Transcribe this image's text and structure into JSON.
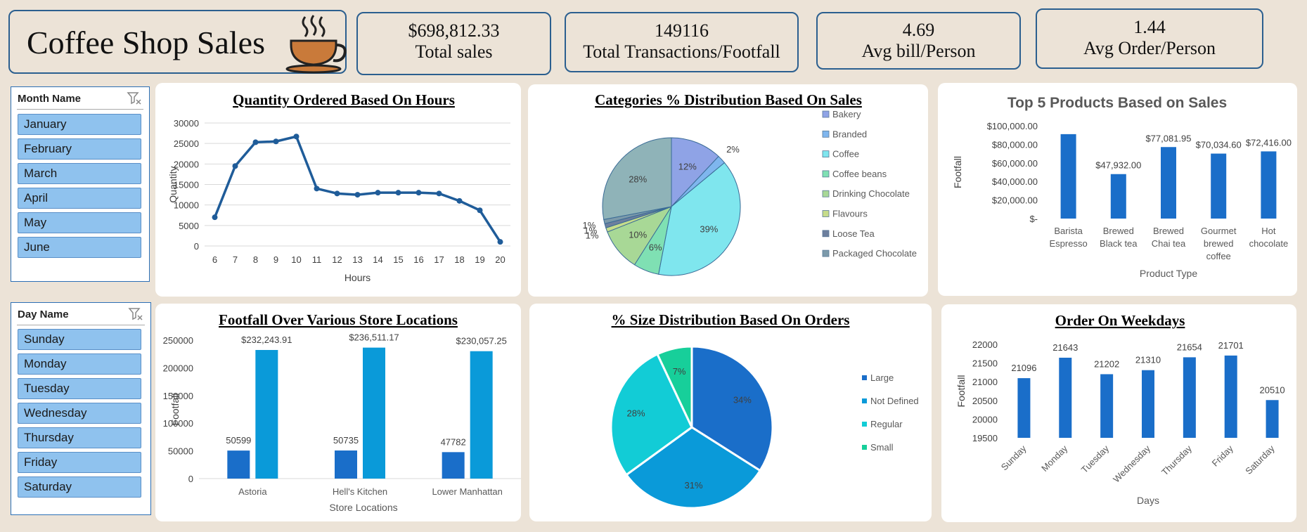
{
  "header": {
    "title": "Coffee Shop Sales"
  },
  "kpis": {
    "total_sales": {
      "value": "$698,812.33",
      "label": "Total sales"
    },
    "transactions": {
      "value": "149116",
      "label": "Total Transactions/Footfall"
    },
    "avg_bill": {
      "value": "4.69",
      "label": "Avg bill/Person"
    },
    "avg_order": {
      "value": "1.44",
      "label": "Avg Order/Person"
    }
  },
  "month_slicer": {
    "header": "Month Name",
    "items": [
      "January",
      "February",
      "March",
      "April",
      "May",
      "June"
    ]
  },
  "day_slicer": {
    "header": "Day Name",
    "items": [
      "Sunday",
      "Monday",
      "Tuesday",
      "Wednesday",
      "Thursday",
      "Friday",
      "Saturday"
    ]
  },
  "colors": {
    "line": "#1f5c99",
    "bar_dark": "#1a6ec9",
    "bar_light": "#0a9ad9",
    "accent_border": "#2b5f8f"
  },
  "chart_data": [
    {
      "id": "hours",
      "type": "line",
      "title": "Quantity Ordered Based On Hours",
      "xlabel": "Hours",
      "ylabel": "Quantity",
      "x": [
        6,
        7,
        8,
        9,
        10,
        11,
        12,
        13,
        14,
        15,
        16,
        17,
        18,
        19,
        20
      ],
      "values": [
        7000,
        19500,
        25300,
        25500,
        26700,
        14000,
        12800,
        12500,
        13000,
        13000,
        13000,
        12800,
        11000,
        8700,
        1000
      ],
      "ylim": [
        0,
        30000
      ],
      "yticks": [
        "30000",
        "25000",
        "20000",
        "15000",
        "10000",
        "5000",
        "0"
      ],
      "grid": true
    },
    {
      "id": "categories",
      "type": "pie",
      "title": "Categories % Distribution Based On Sales",
      "legend_position": "right",
      "slices": [
        {
          "name": "Bakery",
          "value": 12,
          "label": "12%",
          "color": "#8fa3e6"
        },
        {
          "name": "Branded",
          "value": 2,
          "label": "2%",
          "color": "#7fb6ee"
        },
        {
          "name": "Coffee",
          "value": 39,
          "label": "39%",
          "color": "#7fe6ee"
        },
        {
          "name": "Coffee beans",
          "value": 6,
          "label": "6%",
          "color": "#7fe0b3"
        },
        {
          "name": "Drinking Chocolate",
          "value": 10,
          "label": "10%",
          "color": "#a8d896"
        },
        {
          "name": "Flavours",
          "value": 1,
          "label": "1%",
          "color": "#c6dc8a"
        },
        {
          "name": "Loose Tea",
          "value": 1,
          "label": "1%",
          "color": "#6d7f9e"
        },
        {
          "name": "Packaged Chocolate",
          "value": 1,
          "label": "1%",
          "color": "#7c9aaa"
        },
        {
          "name": "",
          "value": 28,
          "label": "28%",
          "color": "#8fb3b8"
        }
      ]
    },
    {
      "id": "top5",
      "type": "bar",
      "title": "Top 5 Products Based on Sales",
      "xlabel": "Product Type",
      "ylabel": "Footfall",
      "categories": [
        [
          "Barista",
          "Espresso"
        ],
        [
          "Brewed",
          "Black tea"
        ],
        [
          "Brewed",
          "Chai tea"
        ],
        [
          "Gourmet",
          "brewed",
          "coffee"
        ],
        [
          "Hot",
          "chocolate"
        ]
      ],
      "values": [
        91000,
        47932,
        77081.95,
        70034.6,
        72416
      ],
      "data_labels": [
        "",
        "$47,932.00",
        "$77,081.95",
        "$70,034.60",
        "$72,416.00"
      ],
      "yticks": [
        "$100,000.00",
        "$80,000.00",
        "$60,000.00",
        "$40,000.00",
        "$20,000.00",
        "$-"
      ],
      "ylim": [
        0,
        100000
      ]
    },
    {
      "id": "stores",
      "type": "bar",
      "title": "Footfall Over Various Store Locations",
      "xlabel": "Store Locations",
      "ylabel": "Footfall",
      "categories": [
        "Astoria",
        "Hell's Kitchen",
        "Lower Manhattan"
      ],
      "series": [
        {
          "values": [
            50599,
            50735,
            47782
          ],
          "labels": [
            "50599",
            "50735",
            "47782"
          ]
        },
        {
          "values": [
            232243.91,
            236511.17,
            230057.25
          ],
          "labels": [
            "$232,243.91",
            "$236,511.17",
            "$230,057.25"
          ]
        }
      ],
      "yticks": [
        "250000",
        "200000",
        "150000",
        "100000",
        "50000",
        "0"
      ],
      "ylim": [
        0,
        250000
      ]
    },
    {
      "id": "sizes",
      "type": "pie",
      "title": "% Size Distribution Based On Orders",
      "legend_position": "right",
      "slices": [
        {
          "name": "Large",
          "value": 34,
          "label": "34%",
          "color": "#1a6ec9"
        },
        {
          "name": "Not Defined",
          "value": 31,
          "label": "31%",
          "color": "#0a9ad9"
        },
        {
          "name": "Regular",
          "value": 28,
          "label": "28%",
          "color": "#12ccd6"
        },
        {
          "name": "Small",
          "value": 7,
          "label": "7%",
          "color": "#17cf9a"
        }
      ]
    },
    {
      "id": "weekdays",
      "type": "bar",
      "title": "Order On Weekdays",
      "xlabel": "Days",
      "ylabel": "Footfall",
      "categories": [
        "Sunday",
        "Monday",
        "Tuesday",
        "Wednesday",
        "Thursday",
        "Friday",
        "Saturday"
      ],
      "values": [
        21096,
        21643,
        21202,
        21310,
        21654,
        21701,
        20510
      ],
      "yticks": [
        "22000",
        "21500",
        "21000",
        "20500",
        "20000",
        "19500"
      ],
      "ylim": [
        19500,
        22000
      ]
    }
  ]
}
